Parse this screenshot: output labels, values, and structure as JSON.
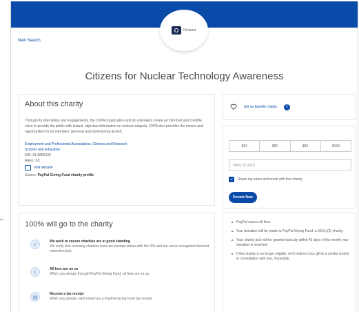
{
  "logo": {
    "text": "Citizens"
  },
  "nav": {
    "new_search": "New Search"
  },
  "org": {
    "name": "Citizens for Nuclear Technology Awareness"
  },
  "about": {
    "heading": "About this charity",
    "description": "Through its internships and engagements, the CNTA organization and its volunteers create an informed and credible voice to provide the public with factual, objective information on nuclear subjects. CNTA also provides the means and opportunities for its members' personal and professional growth.",
    "category_line1": "Employment and Professional Associations, Citizens and Research",
    "category_line2": "Schools and Education",
    "ein": "EIN: 31-0865320",
    "city": "Aiken, SC",
    "website_label": "Visit website",
    "source_prefix": "Source:",
    "source_link": "PayPal Giving Fund charity profile"
  },
  "favorite": {
    "label": "Set as favorite charity",
    "info_glyph": "i"
  },
  "donate": {
    "amounts": [
      "$10",
      "$25",
      "$50",
      "$100"
    ],
    "other_placeholder": "Other ($ USD)",
    "share_label": "Share my name and email with this charity",
    "button_label": "Donate Now"
  },
  "goes": {
    "heading": "100% will go to the charity",
    "items": [
      {
        "title": "We work to ensure charities are in good standing",
        "text": "We verify that receiving charities have tax-exempt status with the IRS and are not on recognized terrorist restriction lists."
      },
      {
        "title": "All fees are on us",
        "text": "When you donate through PayPal Giving Fund, all fees are on us."
      },
      {
        "title": "Receive a tax receipt",
        "text": "When you donate, we'll email you a PayPal Giving Fund tax receipt."
      }
    ]
  },
  "notes": {
    "items": [
      "PayPal covers all fees.",
      "Your donation will be made to PayPal Giving Fund, a 501(c)(3) charity.",
      "Your charity pick will be granted typically within 45 days of the month your donation is received.",
      "If this charity is no longer eligible, we'll redirect your gift to a similar charity in consultation with you, if possible."
    ]
  },
  "colors": {
    "brand": "#0a4aa8",
    "topbar": "#0a4aa8",
    "panel_border": "#e4e6e8"
  },
  "icons": [
    "heart-icon",
    "info-icon",
    "website-icon",
    "check-icon",
    "shield-icon",
    "info-circle-icon",
    "receipt-icon"
  ]
}
